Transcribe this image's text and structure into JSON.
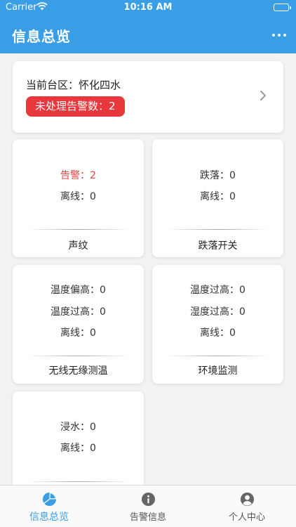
{
  "status_bar": {
    "carrier": "Carrier",
    "time": "10:16 AM"
  },
  "header": {
    "title": "信息总览",
    "menu_icon": "more-icon"
  },
  "district": {
    "label": "当前台区：怀化四水",
    "unhandled": "未处理告警数：2",
    "chevron": "chevron-right-icon"
  },
  "devices": [
    {
      "stats": [
        "告警：2",
        "离线：0"
      ],
      "name": "声纹"
    },
    {
      "stats": [
        "跌落：0",
        "离线：0"
      ],
      "name": "跌落开关"
    },
    {
      "stats": [
        "温度偏高：0",
        "温度过高：0",
        "离线：0"
      ],
      "name": "无线无缘测温"
    },
    {
      "stats": [
        "温度过高：0",
        "湿度过高：0",
        "离线：0"
      ],
      "name": "环境监测"
    },
    {
      "stats": [
        "浸水：0",
        "离线：0"
      ],
      "name": ""
    }
  ],
  "tabs": [
    {
      "label": "信息总览",
      "icon": "pie-chart-icon",
      "active": true
    },
    {
      "label": "告警信息",
      "icon": "info-icon",
      "active": false
    },
    {
      "label": "个人中心",
      "icon": "user-icon",
      "active": false
    }
  ],
  "colors": {
    "accent": "#3a9ee6",
    "alarm": "#e64040",
    "badge": "#e8383d"
  }
}
